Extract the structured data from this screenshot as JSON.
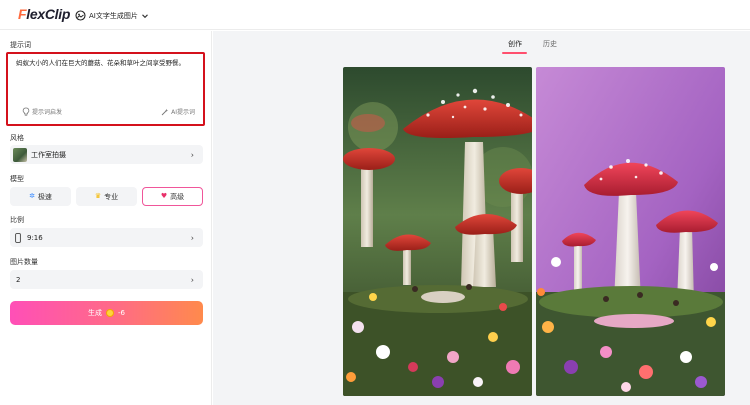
{
  "header": {
    "logo_prefix": "F",
    "logo_rest": "lexClip",
    "mode_label": "AI文字生成图片"
  },
  "prompt": {
    "label": "提示词",
    "text": "蚂蚁大小的人们在巨大的蘑菇、花朵和草叶之间享受野餐。",
    "inspire_label": "提示词启发",
    "ai_label": "AI提示词"
  },
  "style": {
    "label": "风格",
    "value": "工作室拍摄"
  },
  "model": {
    "label": "模型",
    "options": [
      "极速",
      "专业",
      "高级"
    ],
    "selected": "高级"
  },
  "ratio": {
    "label": "比例",
    "value": "9:16"
  },
  "count": {
    "label": "图片数量",
    "value": "2"
  },
  "generate": {
    "label": "生成",
    "cost": "-6"
  },
  "tabs": [
    "创作",
    "历史"
  ],
  "colors": {
    "accent": "#ff4f6e",
    "highlight_border": "#d4111c",
    "generate_start": "#ff4fb7",
    "generate_end": "#ff8a4c"
  }
}
